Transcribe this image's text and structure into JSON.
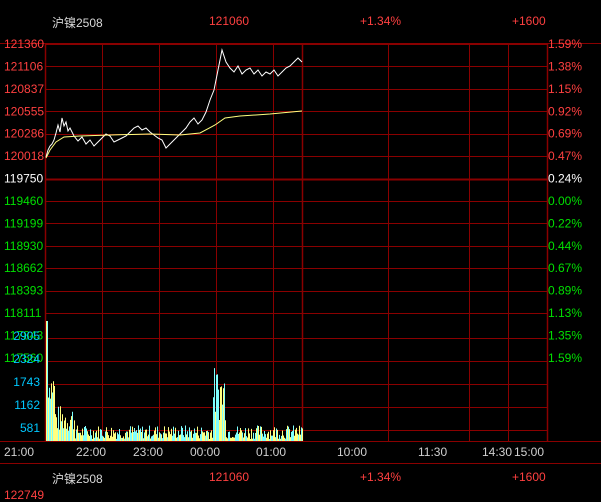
{
  "header": {
    "symbol": "沪镍2508",
    "price": "121060",
    "change_pct": "+1.34%",
    "oi_change": "+1600"
  },
  "footer": {
    "symbol": "沪镍2508",
    "price": "121060",
    "change_pct": "+1.34%",
    "oi_change": "+1600",
    "partial_value": "122749"
  },
  "axis": {
    "price_labels": [
      "121360",
      "121106",
      "120837",
      "120555",
      "120286",
      "120018",
      "119750",
      "119460",
      "119199",
      "118930",
      "118662",
      "118393",
      "118111",
      "117843",
      "117560"
    ],
    "pct_labels": [
      "1.59%",
      "1.38%",
      "1.15%",
      "0.92%",
      "0.69%",
      "0.47%",
      "0.24%",
      "0.00%",
      "0.22%",
      "0.44%",
      "0.67%",
      "0.89%",
      "1.13%",
      "1.35%",
      "1.59%"
    ],
    "volume_labels": [
      "2905",
      "2324",
      "1743",
      "1162",
      "581"
    ],
    "time_labels": [
      "21:00",
      "22:00",
      "23:00",
      "00:00",
      "01:00",
      "10:00",
      "11:30",
      "14:30",
      "15:00"
    ]
  },
  "colors": {
    "background": "#000000",
    "grid": "#8a0000",
    "up": "#ff4040",
    "down": "#00e000",
    "neutral": "#ffffff",
    "price_line": "#ffffff",
    "avg_line": "#ffff80",
    "volume": "#7fffff",
    "volume_alt": "#ffff80",
    "volume_label": "#00c8ff"
  }
}
